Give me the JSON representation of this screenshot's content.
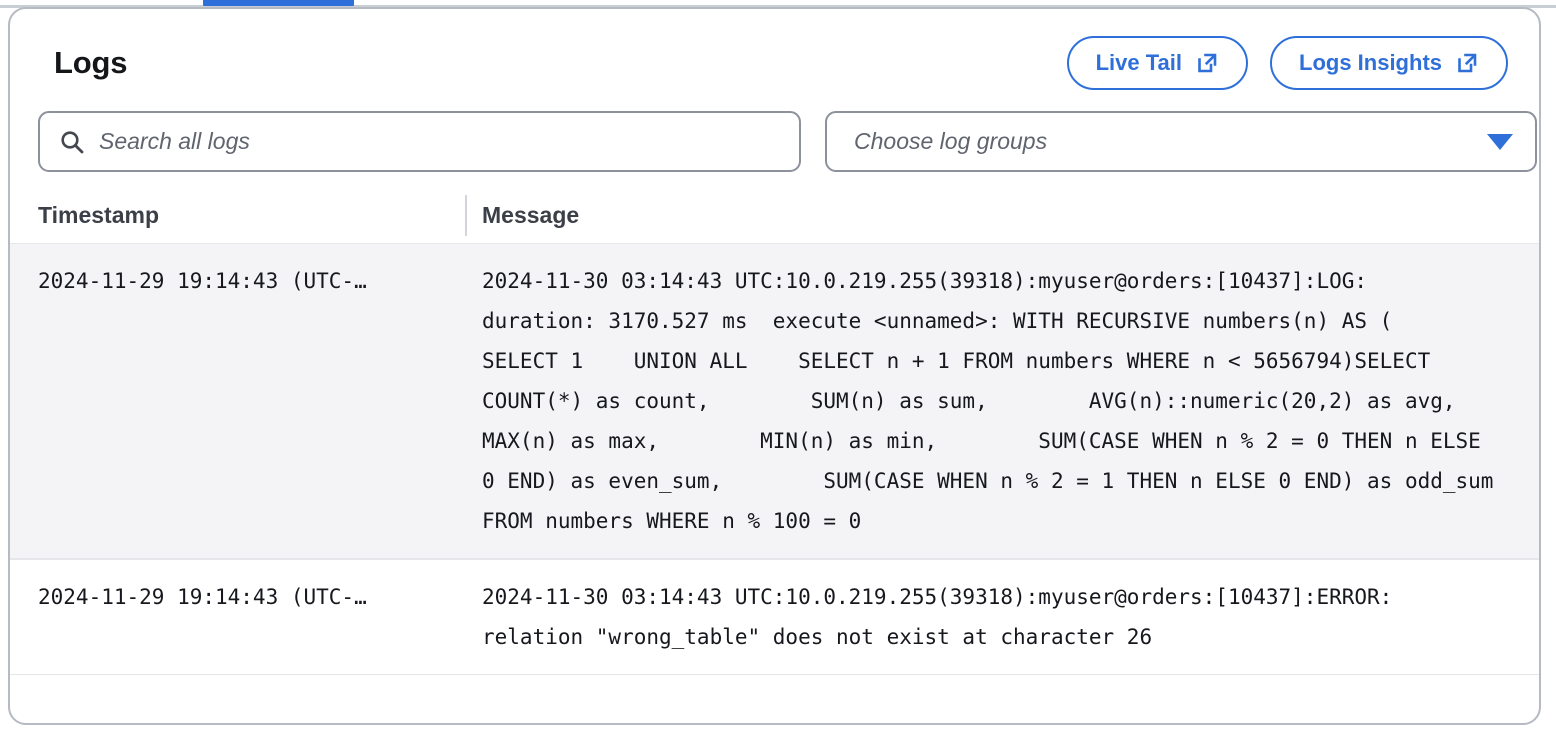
{
  "tab_indicator": {
    "active": true,
    "color": "#2f6fd9"
  },
  "card": {
    "title": "Logs",
    "actions": [
      {
        "label": "Live Tail",
        "icon": "external-link-icon"
      },
      {
        "label": "Logs Insights",
        "icon": "external-link-icon"
      }
    ]
  },
  "filters": {
    "search": {
      "placeholder": "Search all logs",
      "value": "",
      "icon": "search-icon"
    },
    "log_groups": {
      "placeholder": "Choose log groups",
      "value": "",
      "icon": "chevron-down-icon",
      "caret_color": "#2f6fd9"
    }
  },
  "table": {
    "columns": [
      "Timestamp",
      "Message"
    ],
    "rows": [
      {
        "timestamp": "2024-11-29 19:14:43 (UTC-…",
        "message": "2024-11-30 03:14:43 UTC:10.0.219.255(39318):myuser@orders:[10437]:LOG:  duration: 3170.527 ms  execute <unnamed>: WITH RECURSIVE numbers(n) AS (    SELECT 1    UNION ALL    SELECT n + 1 FROM numbers WHERE n < 5656794)SELECT COUNT(*) as count,        SUM(n) as sum,        AVG(n)::numeric(20,2) as avg,        MAX(n) as max,        MIN(n) as min,        SUM(CASE WHEN n % 2 = 0 THEN n ELSE 0 END) as even_sum,        SUM(CASE WHEN n % 2 = 1 THEN n ELSE 0 END) as odd_sum FROM numbers WHERE n % 100 = 0"
      },
      {
        "timestamp": "2024-11-29 19:14:43 (UTC-…",
        "message": "2024-11-30 03:14:43 UTC:10.0.219.255(39318):myuser@orders:[10437]:ERROR:  relation \"wrong_table\" does not exist at character 26"
      }
    ]
  }
}
